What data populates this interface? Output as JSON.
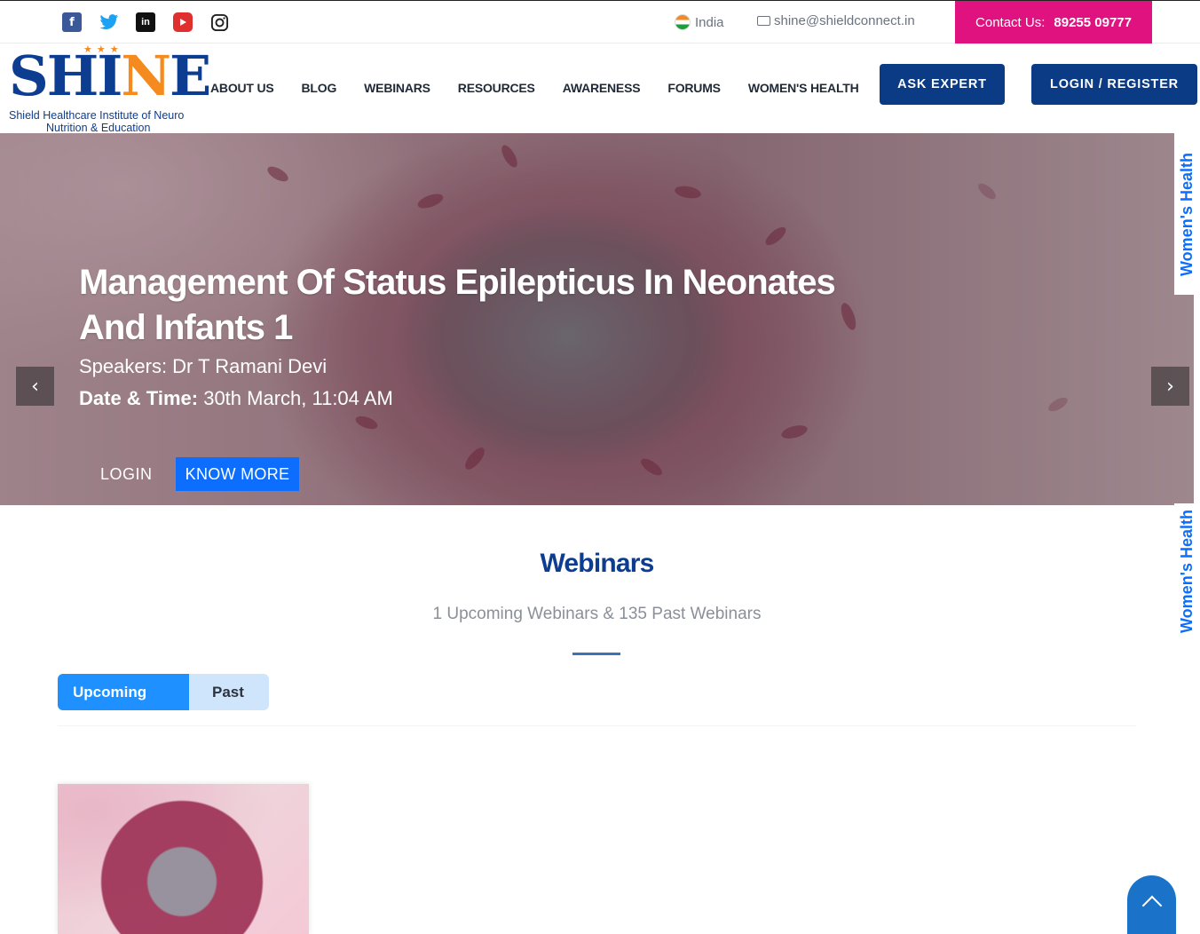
{
  "topbar": {
    "country": "India",
    "email": "shine@shieldconnect.in",
    "contact_label": "Contact Us:",
    "contact_phone": "89255 09777",
    "social_icons": [
      "facebook-icon",
      "twitter-icon",
      "linkedin-icon",
      "youtube-icon",
      "instagram-icon"
    ]
  },
  "logo": {
    "word_a": "SH",
    "word_b": "I",
    "word_n": "N",
    "word_e": "E",
    "tag_line1": "Shield Healthcare Institute of Neuro",
    "tag_line2": "Nutrition & Education"
  },
  "nav": {
    "items": [
      "ABOUT US",
      "BLOG",
      "WEBINARS",
      "RESOURCES",
      "AWARENESS",
      "FORUMS",
      "WOMEN'S HEALTH"
    ],
    "ask_expert": "ASK EXPERT",
    "login_register": "LOGIN / REGISTER"
  },
  "hero": {
    "title": "Management Of Status Epilepticus In Neonates And Infants 1",
    "speakers": "Speakers: Dr T Ramani Devi",
    "date_label": "Date & Time:",
    "date_value": "30th March, 11:04 AM",
    "login": "LOGIN",
    "know_more": "KNOW MORE"
  },
  "side_tabs": {
    "label": "Women's Health"
  },
  "webinars": {
    "title": "Webinars",
    "subtitle": "1 Upcoming Webinars & 135 Past Webinars",
    "tab_upcoming": "Upcoming",
    "tab_past": "Past"
  },
  "colors": {
    "brand_navy": "#0c3b86",
    "brand_orange": "#f58a1f",
    "contact_pink": "#e0127f",
    "tab_active": "#1e90ff",
    "link_blue": "#0d6efd"
  }
}
